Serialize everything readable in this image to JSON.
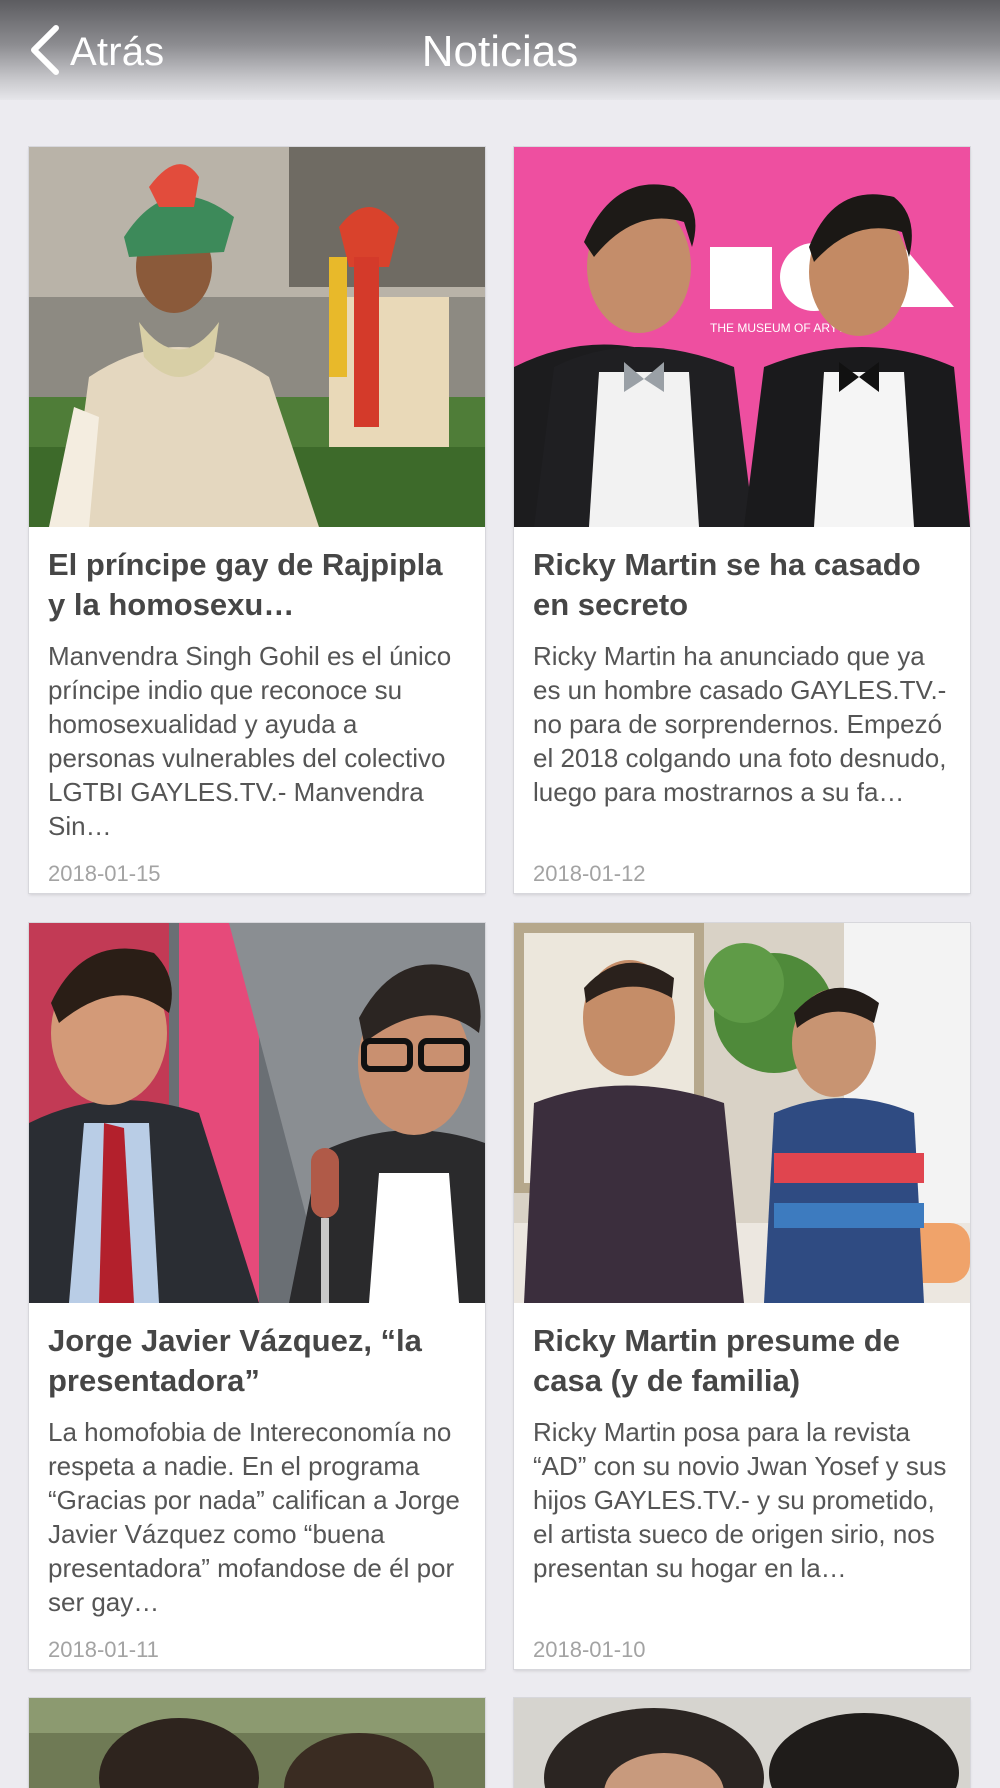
{
  "navbar": {
    "back_label": "Atrás",
    "title": "Noticias",
    "text_color": "#ffffff"
  },
  "articles": [
    {
      "title": "El príncipe gay de Rajpipla y la homosexu…",
      "summary": "Manvendra Singh Gohil es el único príncipe indio que reconoce su homosexualidad y ayuda a personas vulnerables del colectivo LGTBI GAYLES.TV.-  Manvendra Sin…",
      "date": "2018-01-15",
      "image": "photo-prince-in-traditional-dress"
    },
    {
      "title": "Ricky Martin se ha casado en secreto",
      "summary": "Ricky Martin ha anunciado que ya es un hombre casado GAYLES.TV.- no para de sorprendernos. Empezó el 2018 colgando una foto desnudo, luego para mostrarnos a su fa…",
      "date": "2018-01-12",
      "image": "photo-two-men-in-tuxedos",
      "image_text": "THE MUSEUM OF          ARY ART"
    },
    {
      "title": "Jorge Javier Vázquez, “la presentadora”",
      "summary": "La homofobia de Intereconomía no respeta a nadie. En el programa “Gracias por nada” califican a Jorge Javier Vázquez como “buena presentadora” mofandose de él por ser gay…",
      "date": "2018-01-11",
      "image": "photo-two-tv-presenters"
    },
    {
      "title": "Ricky Martin presume de casa (y de familia)",
      "summary": "Ricky Martin posa para la revista “AD” con su novio Jwan Yosef y sus hijos GAYLES.TV.- y su prometido, el artista sueco de origen sirio, nos presentan su hogar en la…",
      "date": "2018-01-10",
      "image": "photo-couple-on-sofa"
    },
    {
      "image": "photo-partial-next-article"
    },
    {
      "image": "photo-partial-next-article"
    }
  ],
  "colors": {
    "background": "#ecebf0",
    "card": "#ffffff",
    "headline": "#464646",
    "summary": "#555555",
    "date": "#a3a3a3"
  }
}
